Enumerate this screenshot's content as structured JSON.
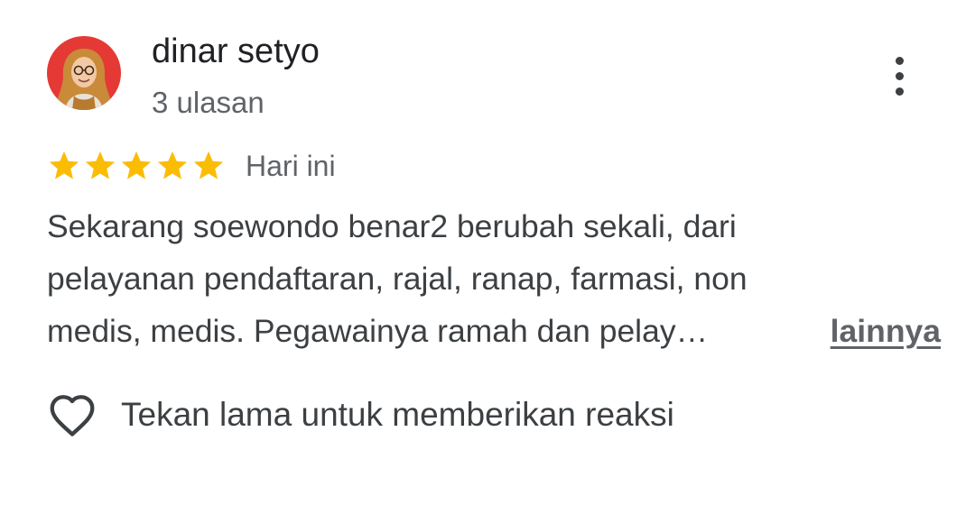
{
  "review": {
    "author": {
      "name": "dinar setyo",
      "reviews_count": "3 ulasan",
      "avatar_icon": "user-avatar-photo",
      "avatar_bg": "#e53935"
    },
    "rating": 5,
    "rating_max": 5,
    "star_color": "#fbbc04",
    "date": "Hari ini",
    "text_lines": [
      "Sekarang soewondo benar2 berubah sekali, dari",
      "pelayanan pendaftaran, rajal, ranap, farmasi, non",
      "medis, medis. Pegawainya ramah dan pelay…"
    ],
    "more_label": "lainnya",
    "menu_icon": "more-vert-icon",
    "reaction": {
      "icon": "heart-outline-icon",
      "label": "Tekan lama untuk memberikan reaksi"
    }
  }
}
